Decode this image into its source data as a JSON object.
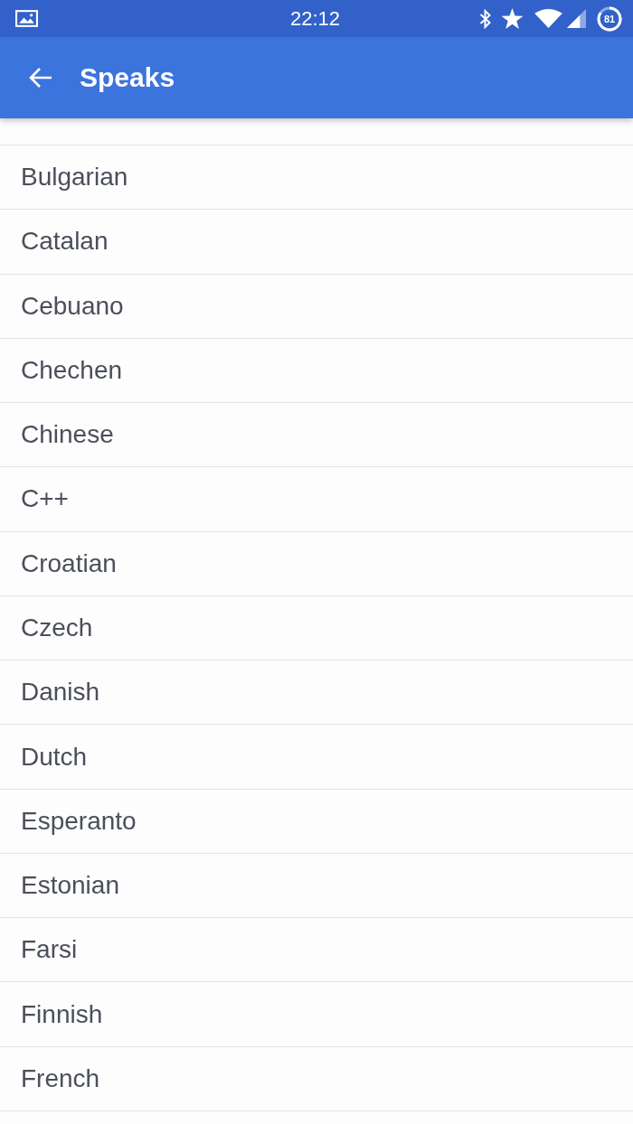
{
  "status_bar": {
    "time": "22:12",
    "battery": "81"
  },
  "app_bar": {
    "title": "Speaks"
  },
  "list": {
    "items": [
      {
        "label": "Bulgarian"
      },
      {
        "label": "Catalan"
      },
      {
        "label": "Cebuano"
      },
      {
        "label": "Chechen"
      },
      {
        "label": "Chinese"
      },
      {
        "label": "C++"
      },
      {
        "label": "Croatian"
      },
      {
        "label": "Czech"
      },
      {
        "label": "Danish"
      },
      {
        "label": "Dutch"
      },
      {
        "label": "Esperanto"
      },
      {
        "label": "Estonian"
      },
      {
        "label": "Farsi"
      },
      {
        "label": "Finnish"
      },
      {
        "label": "French"
      }
    ]
  }
}
